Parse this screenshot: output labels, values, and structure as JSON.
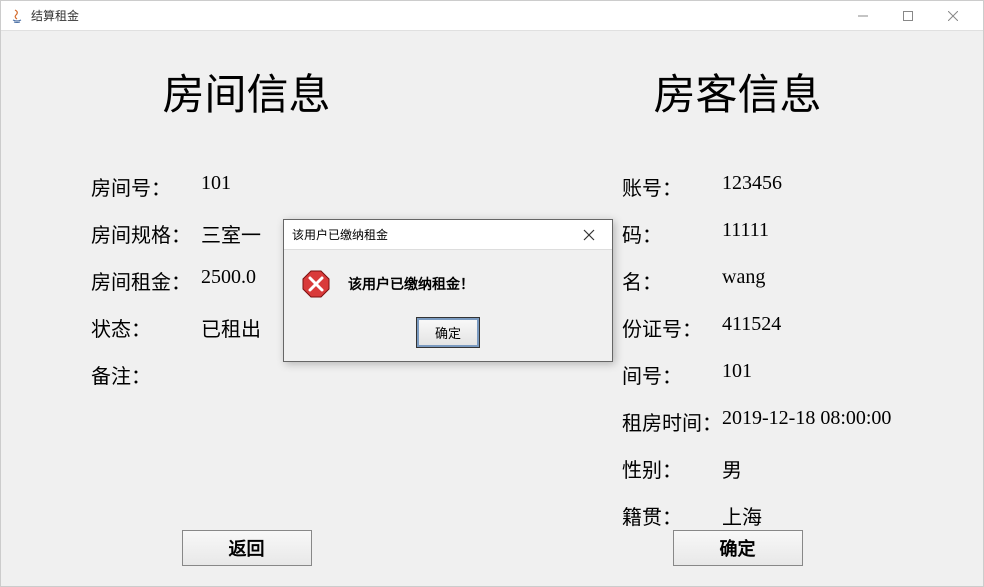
{
  "window": {
    "title": "结算租金"
  },
  "left": {
    "heading": "房间信息",
    "room_number_label": "房间号：",
    "room_number_value": "101",
    "room_spec_label": "房间规格：",
    "room_spec_value": "三室一",
    "room_rent_label": "房间租金：",
    "room_rent_value": "2500.0",
    "status_label": "状态：",
    "status_value": "已租出",
    "remark_label": "备注：",
    "remark_value": "",
    "back_btn": "返回"
  },
  "right": {
    "heading": "房客信息",
    "account_label": "账号：",
    "account_value": "123456",
    "password_label": "码：",
    "password_value": "11111",
    "name_label": "名：",
    "name_value": "wang",
    "idcard_label": "份证号：",
    "idcard_value": "411524",
    "room_label": "间号：",
    "room_value": "101",
    "rent_time_label": "租房时间：",
    "rent_time_value": "2019-12-18 08:00:00",
    "gender_label": "性别：",
    "gender_value": "男",
    "origin_label": "籍贯：",
    "origin_value": "上海",
    "confirm_btn": "确定"
  },
  "dialog": {
    "title": "该用户已缴纳租金",
    "message": "该用户已缴纳租金！",
    "ok_btn": "确定"
  }
}
